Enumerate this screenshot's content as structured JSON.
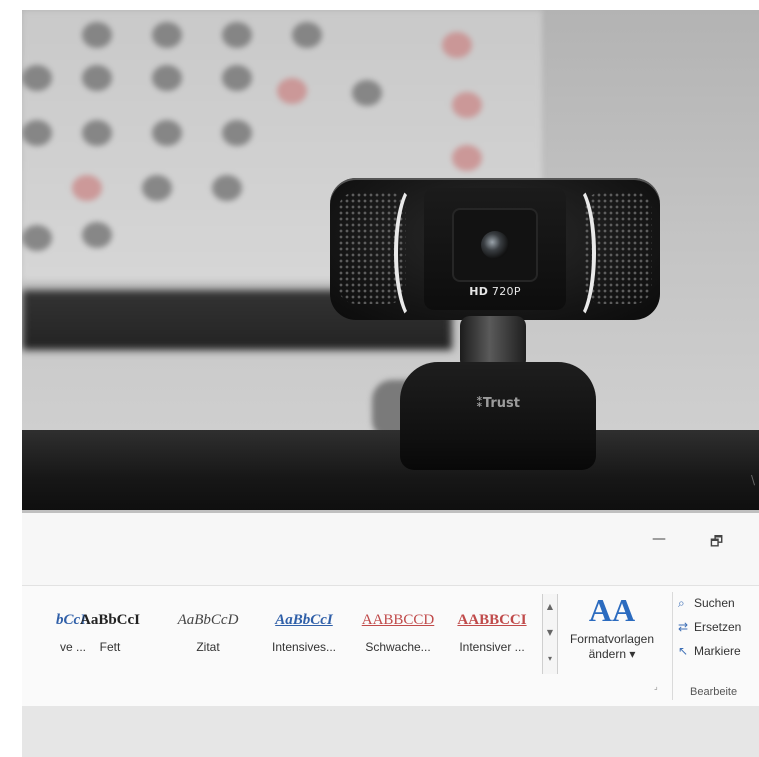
{
  "webcam": {
    "label_bold": "HD",
    "label_rest": " 720P",
    "brand": "Trust"
  },
  "window_controls": {
    "minimize": "—",
    "restore": "🗗"
  },
  "styles_gallery": [
    {
      "sample": "bCcI",
      "name": "ve ...",
      "color": "#2f5fa8",
      "italic": true,
      "bold": true
    },
    {
      "sample": "AaBbCcI",
      "name": "Fett",
      "color": "#222222",
      "italic": false,
      "bold": true
    },
    {
      "sample": "AaBbCcD",
      "name": "Zitat",
      "color": "#444444",
      "italic": true,
      "bold": false
    },
    {
      "sample": "AaBbCcI",
      "name": "Intensives...",
      "color": "#2f5fa8",
      "italic": true,
      "bold": true
    },
    {
      "sample": "AABBCCD",
      "name": "Schwache...",
      "color": "#c04a4a",
      "italic": false,
      "bold": false
    },
    {
      "sample": "AABBCCI",
      "name": "Intensiver ...",
      "color": "#c04a4a",
      "italic": false,
      "bold": true
    }
  ],
  "format_templates": {
    "icon_text": "AA",
    "label_line1": "Formatvorlagen",
    "label_line2": "ändern ▾"
  },
  "edit_group": {
    "search": "Suchen",
    "replace": "Ersetzen",
    "select": "Markiere",
    "title": "Bearbeite"
  }
}
